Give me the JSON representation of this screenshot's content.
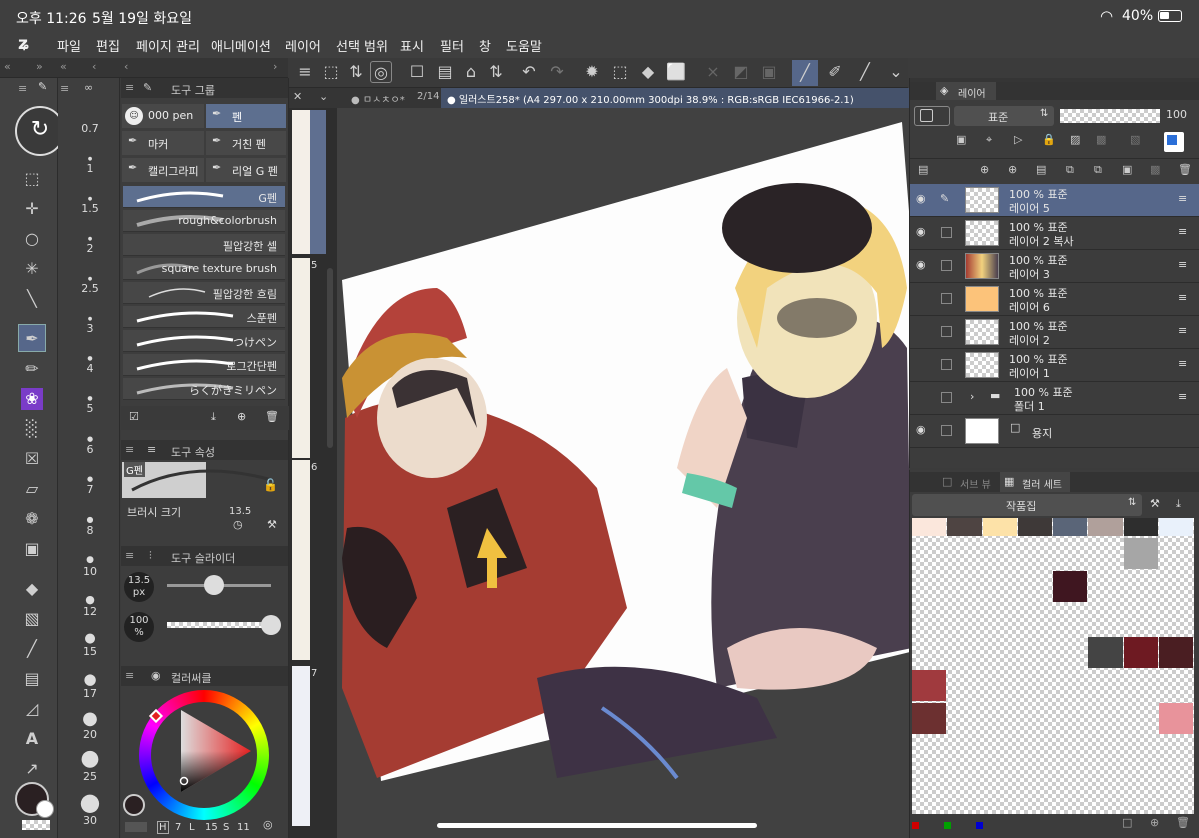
{
  "status": {
    "time": "오후 11:26",
    "date": "5월 19일 화요일",
    "battery": "40%"
  },
  "menu": [
    "파일",
    "편집",
    "페이지 관리",
    "애니메이션",
    "레이어",
    "선택 범위",
    "표시",
    "필터",
    "창",
    "도움말"
  ],
  "sizes": [
    "0.7",
    "1",
    "1.5",
    "2",
    "2.5",
    "3",
    "4",
    "5",
    "6",
    "7",
    "8",
    "10",
    "12",
    "15",
    "17",
    "20",
    "25",
    "30"
  ],
  "tool_group": {
    "title": "도구 그룹",
    "items": [
      {
        "label": "000 pen"
      },
      {
        "label": "펜",
        "selected": true
      },
      {
        "label": "마커"
      },
      {
        "label": "거친 펜"
      },
      {
        "label": "캘리그라피"
      },
      {
        "label": "리얼 G 펜"
      }
    ]
  },
  "brushes": [
    "G펜",
    "rough&colorbrush",
    "필압강한 셀",
    "square texture brush",
    "필압강한 흐림",
    "스푼펜",
    "つけペン",
    "로그간단펜",
    "らくがきミリペン"
  ],
  "tool_property": {
    "title": "도구 속성",
    "brush_name": "G펜",
    "brush_size_label": "브러시 크기",
    "brush_size_value": "13.5"
  },
  "tool_slider": {
    "title": "도구 슬라이더",
    "size_value": "13.5",
    "size_unit": "px",
    "opacity_value": "100",
    "opacity_unit": "%",
    "size_level": 0.45,
    "opacity_level": 1.0
  },
  "color_circle": {
    "title": "컬러써클",
    "h": "H",
    "h_val": "7",
    "l": "L",
    "l_val": "15",
    "s": "S",
    "s_val": "11"
  },
  "pages": [
    "5",
    "6",
    "7"
  ],
  "tab": {
    "counter": "2/14",
    "title": "일러스트258* (A4 297.00 x 210.00mm 300dpi 38.9% : RGB:sRGB IEC61966-2.1)",
    "prev_tab": "ㅁㅅㅊㅇ*"
  },
  "layers_panel": {
    "tab": "레이어",
    "blend": "표준",
    "opacity": "100",
    "layers": [
      {
        "pct": "100 % 표준",
        "name": "레이어 5",
        "visible": true,
        "selected": true,
        "thumb": "sketch"
      },
      {
        "pct": "100 % 표준",
        "name": "레이어 2 복사",
        "visible": true,
        "thumb": "check"
      },
      {
        "pct": "100 % 표준",
        "name": "레이어 3",
        "visible": true,
        "thumb": "art"
      },
      {
        "pct": "100 % 표준",
        "name": "레이어 6",
        "visible": false,
        "thumb": "orange"
      },
      {
        "pct": "100 % 표준",
        "name": "레이어 2",
        "visible": false,
        "thumb": "check"
      },
      {
        "pct": "100 % 표준",
        "name": "레이어 1",
        "visible": false,
        "thumb": "check"
      },
      {
        "pct": "100 % 표준",
        "name": "폴더 1",
        "visible": false,
        "thumb": "folder"
      },
      {
        "pct": "",
        "name": "용지",
        "visible": true,
        "thumb": "white"
      }
    ]
  },
  "color_set": {
    "tabs": [
      "서브 뷰",
      "컬러 세트"
    ],
    "set_name": "작품집",
    "top_colors": [
      "#fbe7dc",
      "#4e4442",
      "#fde2a8",
      "#3e3938",
      "#5a6578",
      "#b0a09b",
      "#2e2e2e",
      "#e9f1fb"
    ],
    "grid": [
      {
        "row": 0,
        "col": 6,
        "color": "#a6a6a6"
      },
      {
        "row": 1,
        "col": 4,
        "color": "#3f1620"
      },
      {
        "row": 3,
        "col": 5,
        "color": "#444444"
      },
      {
        "row": 3,
        "col": 6,
        "color": "#6e1a22"
      },
      {
        "row": 3,
        "col": 7,
        "color": "#4a1e22"
      },
      {
        "row": 4,
        "col": 0,
        "color": "#a03a3e"
      },
      {
        "row": 5,
        "col": 0,
        "color": "#6c3030"
      },
      {
        "row": 5,
        "col": 7,
        "color": "#e8939b"
      }
    ],
    "rgb_dots": [
      "#d00000",
      "#00a000",
      "#0000d0"
    ]
  }
}
